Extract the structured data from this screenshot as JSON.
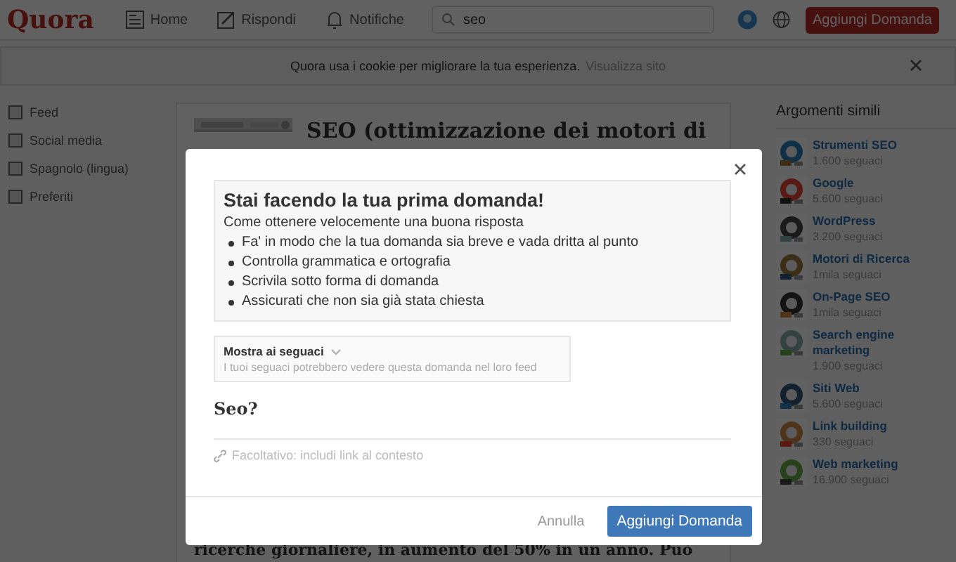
{
  "header": {
    "logo": "Quora",
    "nav": [
      {
        "label": "Home",
        "kind": "home"
      },
      {
        "label": "Rispondi",
        "kind": "answer"
      },
      {
        "label": "Notifiche",
        "kind": "bell"
      }
    ],
    "search": {
      "value": "seo"
    },
    "add_button": "Aggiungi Domanda"
  },
  "cookie_bar": {
    "text": "Quora usa i cookie per migliorare la tua esperienza.",
    "link": "Visualizza sito"
  },
  "sidebar": {
    "items": [
      {
        "label": "Feed"
      },
      {
        "label": "Social media"
      },
      {
        "label": "Spagnolo (lingua)"
      },
      {
        "label": "Preferiti"
      }
    ]
  },
  "main": {
    "title": "SEO (ottimizzazione dei motori di",
    "text": "ricerche giornaliere, in aumento del 50% in un anno. Può"
  },
  "related": {
    "title": "Argomenti simili",
    "items": [
      {
        "name": "Strumenti SEO",
        "followers": "1.600 seguaci"
      },
      {
        "name": "Google",
        "followers": "5.600 seguaci"
      },
      {
        "name": "WordPress",
        "followers": "3.200 seguaci"
      },
      {
        "name": "Motori di Ricerca",
        "followers": "1mila seguaci"
      },
      {
        "name": "On-Page SEO",
        "followers": "1mila seguaci"
      },
      {
        "name": "Search engine marketing",
        "followers": "1.900 seguaci"
      },
      {
        "name": "Siti Web",
        "followers": "5.600 seguaci"
      },
      {
        "name": "Link building",
        "followers": "330 seguaci"
      },
      {
        "name": "Web marketing",
        "followers": "16.900 seguaci"
      }
    ]
  },
  "modal": {
    "tips_title": "Stai facendo la tua prima domanda!",
    "tips_intro": "Come ottenere velocemente una buona risposta",
    "tips": [
      "Fa' in modo che la tua domanda sia breve e vada dritta al punto",
      "Controlla grammatica e ortografia",
      "Scrivila sotto forma di domanda",
      "Assicurati che non sia già stata chiesta"
    ],
    "audience": {
      "label": "Mostra ai seguaci",
      "hint": "I tuoi seguaci potrebbero vedere questa domanda nel loro feed"
    },
    "question": "Seo?",
    "link_placeholder": "Facoltativo: includi link al contesto",
    "cancel": "Annulla",
    "submit": "Aggiungi Domanda"
  }
}
